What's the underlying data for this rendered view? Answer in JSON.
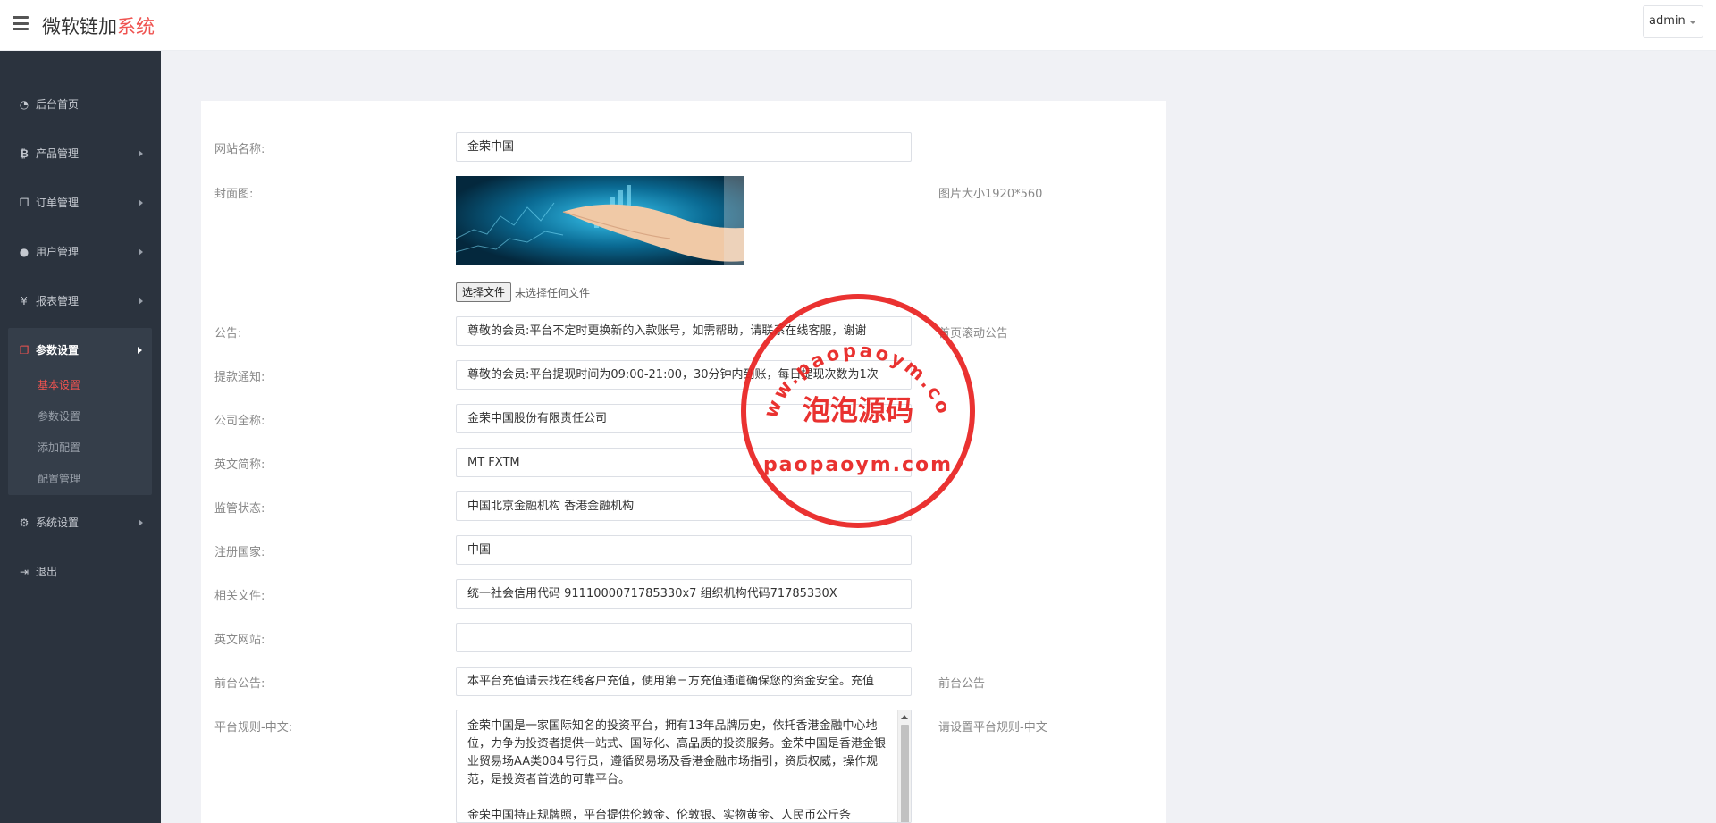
{
  "header": {
    "brand_main": "微软链加",
    "brand_accent": "系统",
    "user_label": "admin"
  },
  "sidebar": {
    "items": [
      {
        "label": "后台首页",
        "icon": "dashboard-icon"
      },
      {
        "label": "产品管理",
        "icon": "bitcoin-icon"
      },
      {
        "label": "订单管理",
        "icon": "copy-icon"
      },
      {
        "label": "用户管理",
        "icon": "user-icon"
      },
      {
        "label": "报表管理",
        "icon": "yen-icon"
      },
      {
        "label": "参数设置",
        "icon": "copy-icon"
      },
      {
        "label": "系统设置",
        "icon": "gears-icon"
      },
      {
        "label": "退出",
        "icon": "sign-out-icon"
      }
    ],
    "sub_items": [
      {
        "label": "基本设置",
        "active": true
      },
      {
        "label": "参数设置",
        "active": false
      },
      {
        "label": "添加配置",
        "active": false
      },
      {
        "label": "配置管理",
        "active": false
      }
    ]
  },
  "form": {
    "site_name": {
      "label": "网站名称:",
      "value": "金荣中国"
    },
    "cover": {
      "label": "封面图:",
      "hint": "图片大小1920*560",
      "file_button": "选择文件",
      "file_status": "未选择任何文件"
    },
    "notice": {
      "label": "公告:",
      "value": "尊敬的会员:平台不定时更换新的入款账号，如需帮助，请联系在线客服，谢谢",
      "hint": "首页滚动公告"
    },
    "withdraw_notice": {
      "label": "提款通知:",
      "value": "尊敬的会员:平台提现时间为09:00-21:00，30分钟内到账，每日提现次数为1次"
    },
    "company_name": {
      "label": "公司全称:",
      "value": "金荣中国股份有限责任公司"
    },
    "english_abbr": {
      "label": "英文简称:",
      "value": "MT FXTM"
    },
    "regulation": {
      "label": "监管状态:",
      "value": "中国北京金融机构 香港金融机构"
    },
    "country": {
      "label": "注册国家:",
      "value": "中国"
    },
    "documents": {
      "label": "相关文件:",
      "value": "统一社会信用代码 9111000071785330x7 组织机构代码71785330X"
    },
    "english_site": {
      "label": "英文网站:",
      "value": ""
    },
    "front_notice": {
      "label": "前台公告:",
      "value": "本平台充值请去找在线客户充值，使用第三方充值通道确保您的资金安全。充值",
      "hint": "前台公告"
    },
    "rules_cn": {
      "label": "平台规则-中文:",
      "hint": "请设置平台规则-中文",
      "value": "金荣中国是一家国际知名的投资平台，拥有13年品牌历史，依托香港金融中心地位，力争为投资者提供一站式、国际化、高品质的投资服务。金荣中国是香港金银业贸易场AA类084号行员，遵循贸易场及香港金融市场指引，资质权威，操作规范，是投资者首选的可靠平台。\n\n金荣中国持正规牌照，平台提供伦敦金、伦敦银、实物黄金、人民币公斤条"
    }
  },
  "watermark": {
    "arc_text": "www.paopaoym.com",
    "center_text": "泡泡源码",
    "bottom_text": "paopaoym.com",
    "color": "#e8211f"
  }
}
